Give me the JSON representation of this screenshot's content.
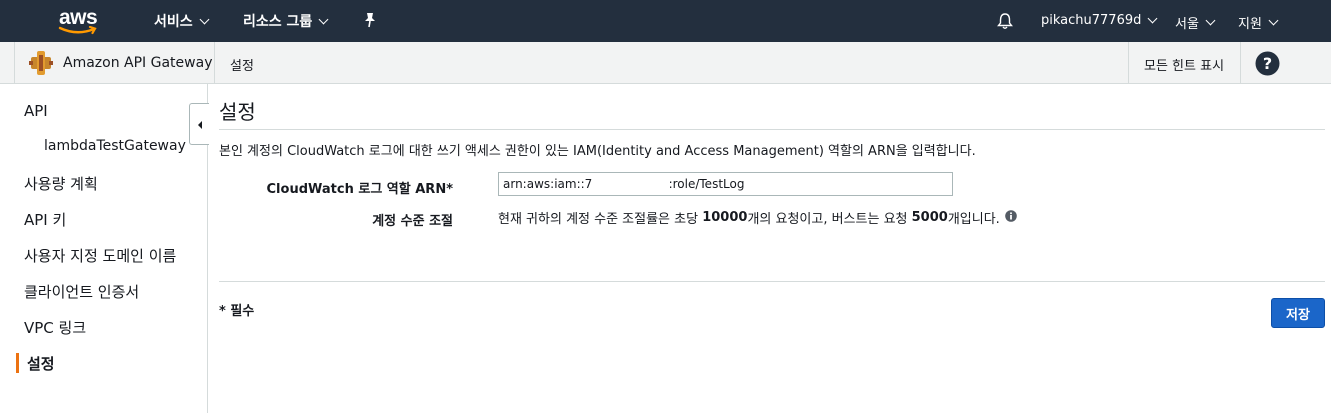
{
  "topnav": {
    "logo_text": "aws",
    "services_label": "서비스",
    "resource_groups_label": "리소스 그룹",
    "pin_icon": "pin-icon",
    "bell_icon": "bell-icon",
    "account": "pikachu77769d",
    "region": "서울",
    "support": "지원",
    "background": "#232f3e"
  },
  "subbar": {
    "service_name": "Amazon API Gateway",
    "breadcrumb": "설정",
    "hints_label": "모든 힌트 표시",
    "help_icon": "help-icon"
  },
  "sidebar": {
    "items": [
      {
        "label": "API"
      },
      {
        "label": "lambdaTestGateway"
      },
      {
        "label": "사용량 계획"
      },
      {
        "label": "API 키"
      },
      {
        "label": "사용자 지정 도메인 이름"
      },
      {
        "label": "클라이언트 인증서"
      },
      {
        "label": "VPC 링크"
      },
      {
        "label": "설정"
      }
    ],
    "active_color": "#ec7211"
  },
  "main": {
    "title": "설정",
    "description": "본인 계정의 CloudWatch 로그에 대한 쓰기 액세스 권한이 있는 IAM(Identity and Access Management) 역할의 ARN을 입력합니다.",
    "arn_label": "CloudWatch 로그 역할 ARN*",
    "arn_value": "arn:aws:iam::7                    :role/TestLog",
    "throttle_label": "계정 수준 조절",
    "throttle_text_1": "현재 귀하의 계정 수준 조절률은 초당 ",
    "throttle_rate": "10000",
    "throttle_text_2": "개의 요청이고, 버스트는 요청 ",
    "throttle_burst": "5000",
    "throttle_text_3": "개입니다.",
    "required_note": "* 필수",
    "save_label": "저장",
    "save_color": "#1b66c9"
  }
}
